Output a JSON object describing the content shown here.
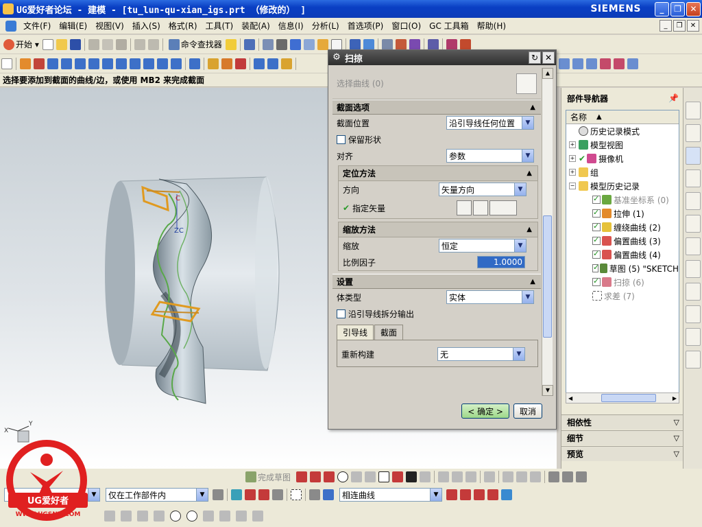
{
  "window": {
    "title": "UG爱好者论坛 - 建模 - [tu_lun-qu-xian_igs.prt （修改的） ]",
    "brand": "SIEMENS"
  },
  "menu": [
    "文件(F)",
    "编辑(E)",
    "视图(V)",
    "插入(S)",
    "格式(R)",
    "工具(T)",
    "装配(A)",
    "信息(I)",
    "分析(L)",
    "首选项(P)",
    "窗口(O)",
    "GC 工具箱",
    "帮助(H)"
  ],
  "toolbar": {
    "start_label": "开始",
    "command_finder_label": "命令查找器"
  },
  "status_prompt": "选择要添加到截面的曲线/边，或使用 MB2 来完成截面",
  "viewport": {
    "zc_label": "ZC",
    "c_label": "C",
    "axis_x": "X",
    "axis_y": "Y"
  },
  "dialog": {
    "title": "扫掠",
    "select_curve_label": "选择曲线 (0)",
    "section_options": {
      "header": "截面选项",
      "position_label": "截面位置",
      "position_value": "沿引导线任何位置",
      "keep_shape_label": "保留形状",
      "align_label": "对齐",
      "align_value": "参数"
    },
    "orientation": {
      "header": "定位方法",
      "direction_label": "方向",
      "direction_value": "矢量方向",
      "specify_vector_label": "指定矢量"
    },
    "scaling": {
      "header": "缩放方法",
      "scale_label": "缩放",
      "scale_value": "恒定",
      "factor_label": "比例因子",
      "factor_value": "1.0000"
    },
    "settings": {
      "header": "设置",
      "body_type_label": "体类型",
      "body_type_value": "实体",
      "split_output_label": "沿引导线拆分输出",
      "tabs": [
        "引导线",
        "截面"
      ],
      "rebuild_label": "重新构建",
      "rebuild_value": "无"
    },
    "ok_label": "< 确定 >",
    "cancel_label": "取消"
  },
  "navigator": {
    "title": "部件导航器",
    "column_name": "名称",
    "nodes": [
      {
        "label": "历史记录模式"
      },
      {
        "label": "模型视图"
      },
      {
        "label": "摄像机"
      },
      {
        "label": "组"
      },
      {
        "label": "模型历史记录"
      },
      {
        "label": "基准坐标系 (0)"
      },
      {
        "label": "拉伸 (1)"
      },
      {
        "label": "缠绕曲线 (2)"
      },
      {
        "label": "偏置曲线 (3)"
      },
      {
        "label": "偏置曲线 (4)"
      },
      {
        "label": "草图 (5) \"SKETCH"
      },
      {
        "label": "扫掠 (6)"
      },
      {
        "label": "求差 (7)"
      }
    ],
    "sections": [
      "相依性",
      "细节",
      "预览"
    ]
  },
  "bottom": {
    "finish_sketch_label": "完成草图",
    "scope_value": "仅在工作部件内",
    "curve_rule_value": "相连曲线"
  },
  "logo": {
    "text": "UG爱好者",
    "url": "WWW.UGSNX.COM"
  }
}
